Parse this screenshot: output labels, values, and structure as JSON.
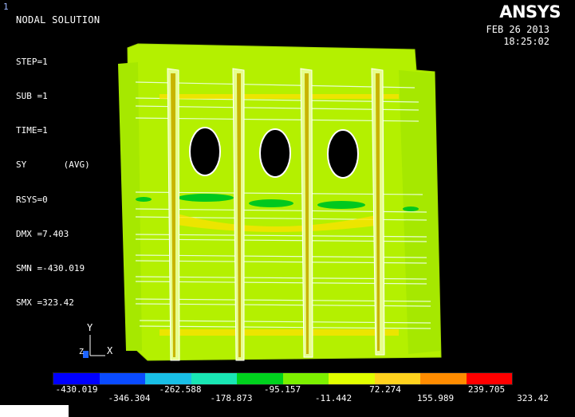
{
  "window": {
    "number": "1"
  },
  "header": {
    "title": "NODAL SOLUTION",
    "info_lines": [
      "STEP=1",
      "SUB =1",
      "TIME=1",
      "SY       (AVG)",
      "RSYS=0",
      "DMX =7.403",
      "SMN =-430.019",
      "SMX =323.42"
    ],
    "logo": "ANSYS",
    "date": "FEB 26 2013",
    "time": "18:25:02"
  },
  "triad": {
    "y_label": "Y",
    "x_label": "X",
    "z_label": "Z"
  },
  "legend": {
    "colors": [
      "#0000ff",
      "#0a4bff",
      "#19bfe6",
      "#19e6b4",
      "#00d21e",
      "#7df000",
      "#e1ff00",
      "#ffd21e",
      "#ff8c00",
      "#ff0000"
    ],
    "upper_labels": [
      "-430.019",
      "-262.588",
      "-95.157",
      "72.274",
      "239.705"
    ],
    "lower_labels": [
      "-346.304",
      "-178.873",
      "-11.442",
      "155.989",
      "323.42"
    ]
  },
  "colors": {
    "plate": "#b4f000",
    "plate_edge": "#9cd400",
    "stiffener": "#ffe100",
    "hotspot": "#00c81e",
    "background": "#000000"
  }
}
